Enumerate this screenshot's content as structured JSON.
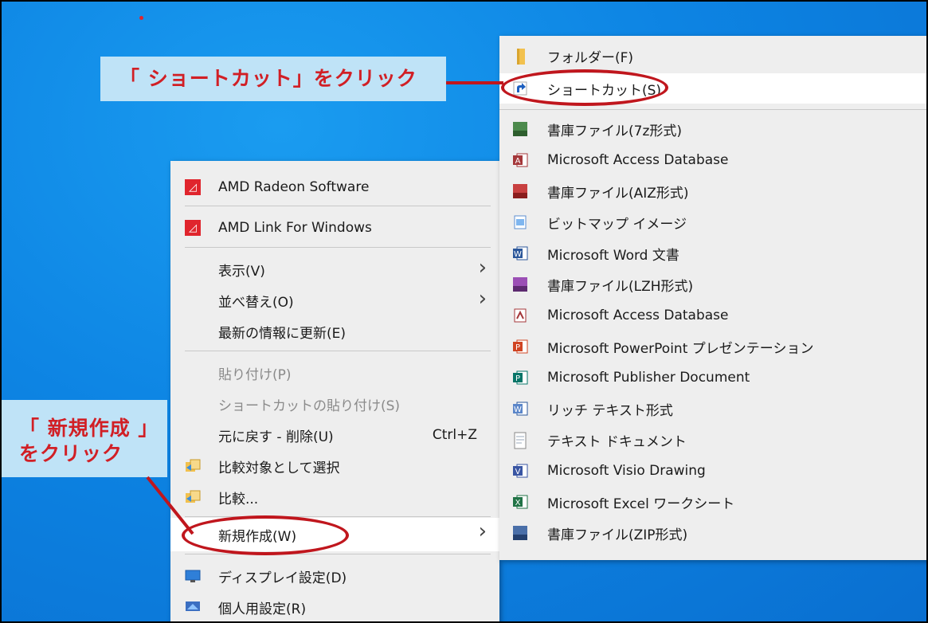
{
  "context_menu": {
    "items": [
      {
        "label": "AMD Radeon Software",
        "icon": "amd-icon"
      },
      {
        "label": "AMD Link For Windows",
        "icon": "amd-icon"
      },
      {
        "label": "表示(V)"
      },
      {
        "label": "並べ替え(O)"
      },
      {
        "label": "最新の情報に更新(E)"
      },
      {
        "label": "貼り付け(P)",
        "disabled": true
      },
      {
        "label": "ショートカットの貼り付け(S)",
        "disabled": true
      },
      {
        "label": "元に戻す - 削除(U)",
        "shortcut": "Ctrl+Z"
      },
      {
        "label": "比較対象として選択",
        "icon": "compare-icon"
      },
      {
        "label": "比較...",
        "icon": "compare-icon"
      },
      {
        "label": "新規作成(W)"
      },
      {
        "label": "ディスプレイ設定(D)",
        "icon": "display-icon"
      },
      {
        "label": "個人用設定(R)",
        "icon": "personalize-icon"
      }
    ]
  },
  "submenu": {
    "items": [
      {
        "label": "フォルダー(F)",
        "icon": "folder-icon"
      },
      {
        "label": "ショートカット(S)",
        "icon": "shortcut-icon"
      },
      {
        "label": "書庫ファイル(7z形式)",
        "icon": "archive-7z-icon"
      },
      {
        "label": "Microsoft Access Database",
        "icon": "access-icon"
      },
      {
        "label": "書庫ファイル(AIZ形式)",
        "icon": "archive-aiz-icon"
      },
      {
        "label": "ビットマップ イメージ",
        "icon": "bitmap-icon"
      },
      {
        "label": "Microsoft Word 文書",
        "icon": "word-icon"
      },
      {
        "label": "書庫ファイル(LZH形式)",
        "icon": "archive-lzh-icon"
      },
      {
        "label": "Microsoft Access Database",
        "icon": "access-icon"
      },
      {
        "label": "Microsoft PowerPoint プレゼンテーション",
        "icon": "powerpoint-icon"
      },
      {
        "label": "Microsoft Publisher Document",
        "icon": "publisher-icon"
      },
      {
        "label": "リッチ テキスト形式",
        "icon": "rtf-icon"
      },
      {
        "label": "テキスト ドキュメント",
        "icon": "text-icon"
      },
      {
        "label": "Microsoft Visio Drawing",
        "icon": "visio-icon"
      },
      {
        "label": "Microsoft Excel ワークシート",
        "icon": "excel-icon"
      },
      {
        "label": "書庫ファイル(ZIP形式)",
        "icon": "archive-zip-icon"
      }
    ]
  },
  "annotations": {
    "shortcut_callout": "「 ショートカット」をクリック",
    "new_callout_line1": "「 新規作成 」",
    "new_callout_line2": "をクリック",
    "color": "#c0161d"
  },
  "colors": {
    "desktop": "#0d84e3",
    "menu_bg": "#eeeeee",
    "highlight": "#ffffff",
    "amd_red": "#e0252d"
  }
}
